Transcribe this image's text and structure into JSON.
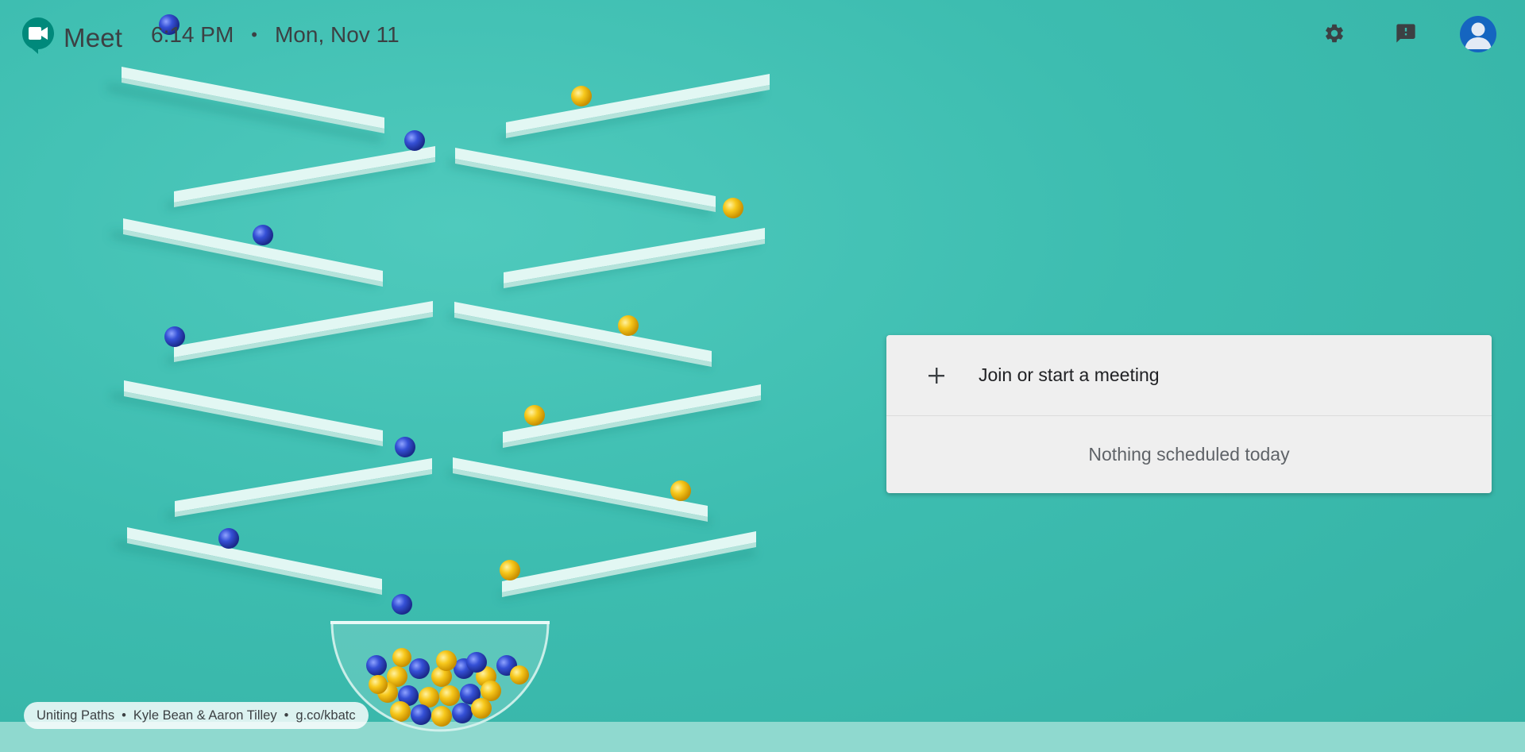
{
  "app": {
    "name": "Meet",
    "logo_icon": "google-meet-logo-icon",
    "brand_colors": {
      "logo_green": "#00897b",
      "logo_dark": "#00796b",
      "background": "#3dbdb0",
      "avatar": "#1565c0"
    }
  },
  "header": {
    "time": "6:14 PM",
    "separator": "•",
    "date": "Mon, Nov 11",
    "settings_icon": "gear-icon",
    "feedback_icon": "feedback-icon",
    "account_icon": "account-avatar-icon"
  },
  "card": {
    "join_icon": "plus-icon",
    "join_label": "Join or start a meeting",
    "empty_message": "Nothing scheduled today"
  },
  "attribution": {
    "title": "Uniting Paths",
    "artists": "Kyle Bean & Aaron Tilley",
    "link": "g.co/kbatc",
    "separator": "•"
  },
  "artwork": {
    "description_colors": {
      "ramp": "#cdeee8",
      "blue_ball": "#2f47c9",
      "yellow_ball": "#f5c518"
    }
  }
}
